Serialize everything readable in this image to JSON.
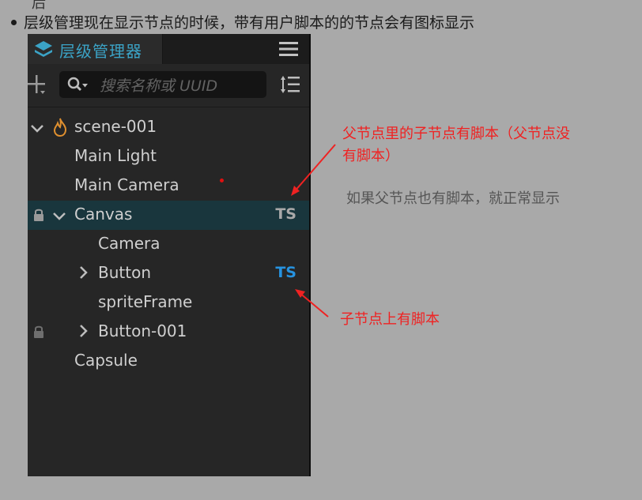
{
  "doc": {
    "top_fragment": "后",
    "bullet_text": "层级管理现在显示节点的时候，带有用户脚本的的节点会有图标显示"
  },
  "panel": {
    "title": "层级管理器",
    "search_placeholder": "搜索名称或 UUID",
    "accent_color": "#3ba3c6",
    "icons": [
      "layers-icon",
      "hamburger-menu-icon",
      "add-icon",
      "search-icon",
      "sort-list-icon",
      "chevron-down-icon",
      "chevron-right-icon",
      "lock-icon",
      "scene-flame-icon"
    ]
  },
  "tree": [
    {
      "label": "scene-001",
      "expanded": true,
      "icon": "scene-flame-icon"
    },
    {
      "label": "Main Light"
    },
    {
      "label": "Main Camera"
    },
    {
      "label": "Canvas",
      "expanded": true,
      "locked": true,
      "selected": true,
      "badge": "TS"
    },
    {
      "label": "Camera"
    },
    {
      "label": "Button",
      "expanded": false,
      "badge": "TS",
      "badge_color": "#2793e0"
    },
    {
      "label": "spriteFrame"
    },
    {
      "label": "Button-001",
      "expanded": false,
      "locked": true
    },
    {
      "label": "Capsule"
    }
  ],
  "annotations": {
    "parent_note_line1": "父节点里的子节点有脚本（父节点没",
    "parent_note_line2": "有脚本）",
    "gray_note": "如果父节点也有脚本，就正常显示",
    "child_note": "子节点上有脚本",
    "color": "#ef2222"
  }
}
